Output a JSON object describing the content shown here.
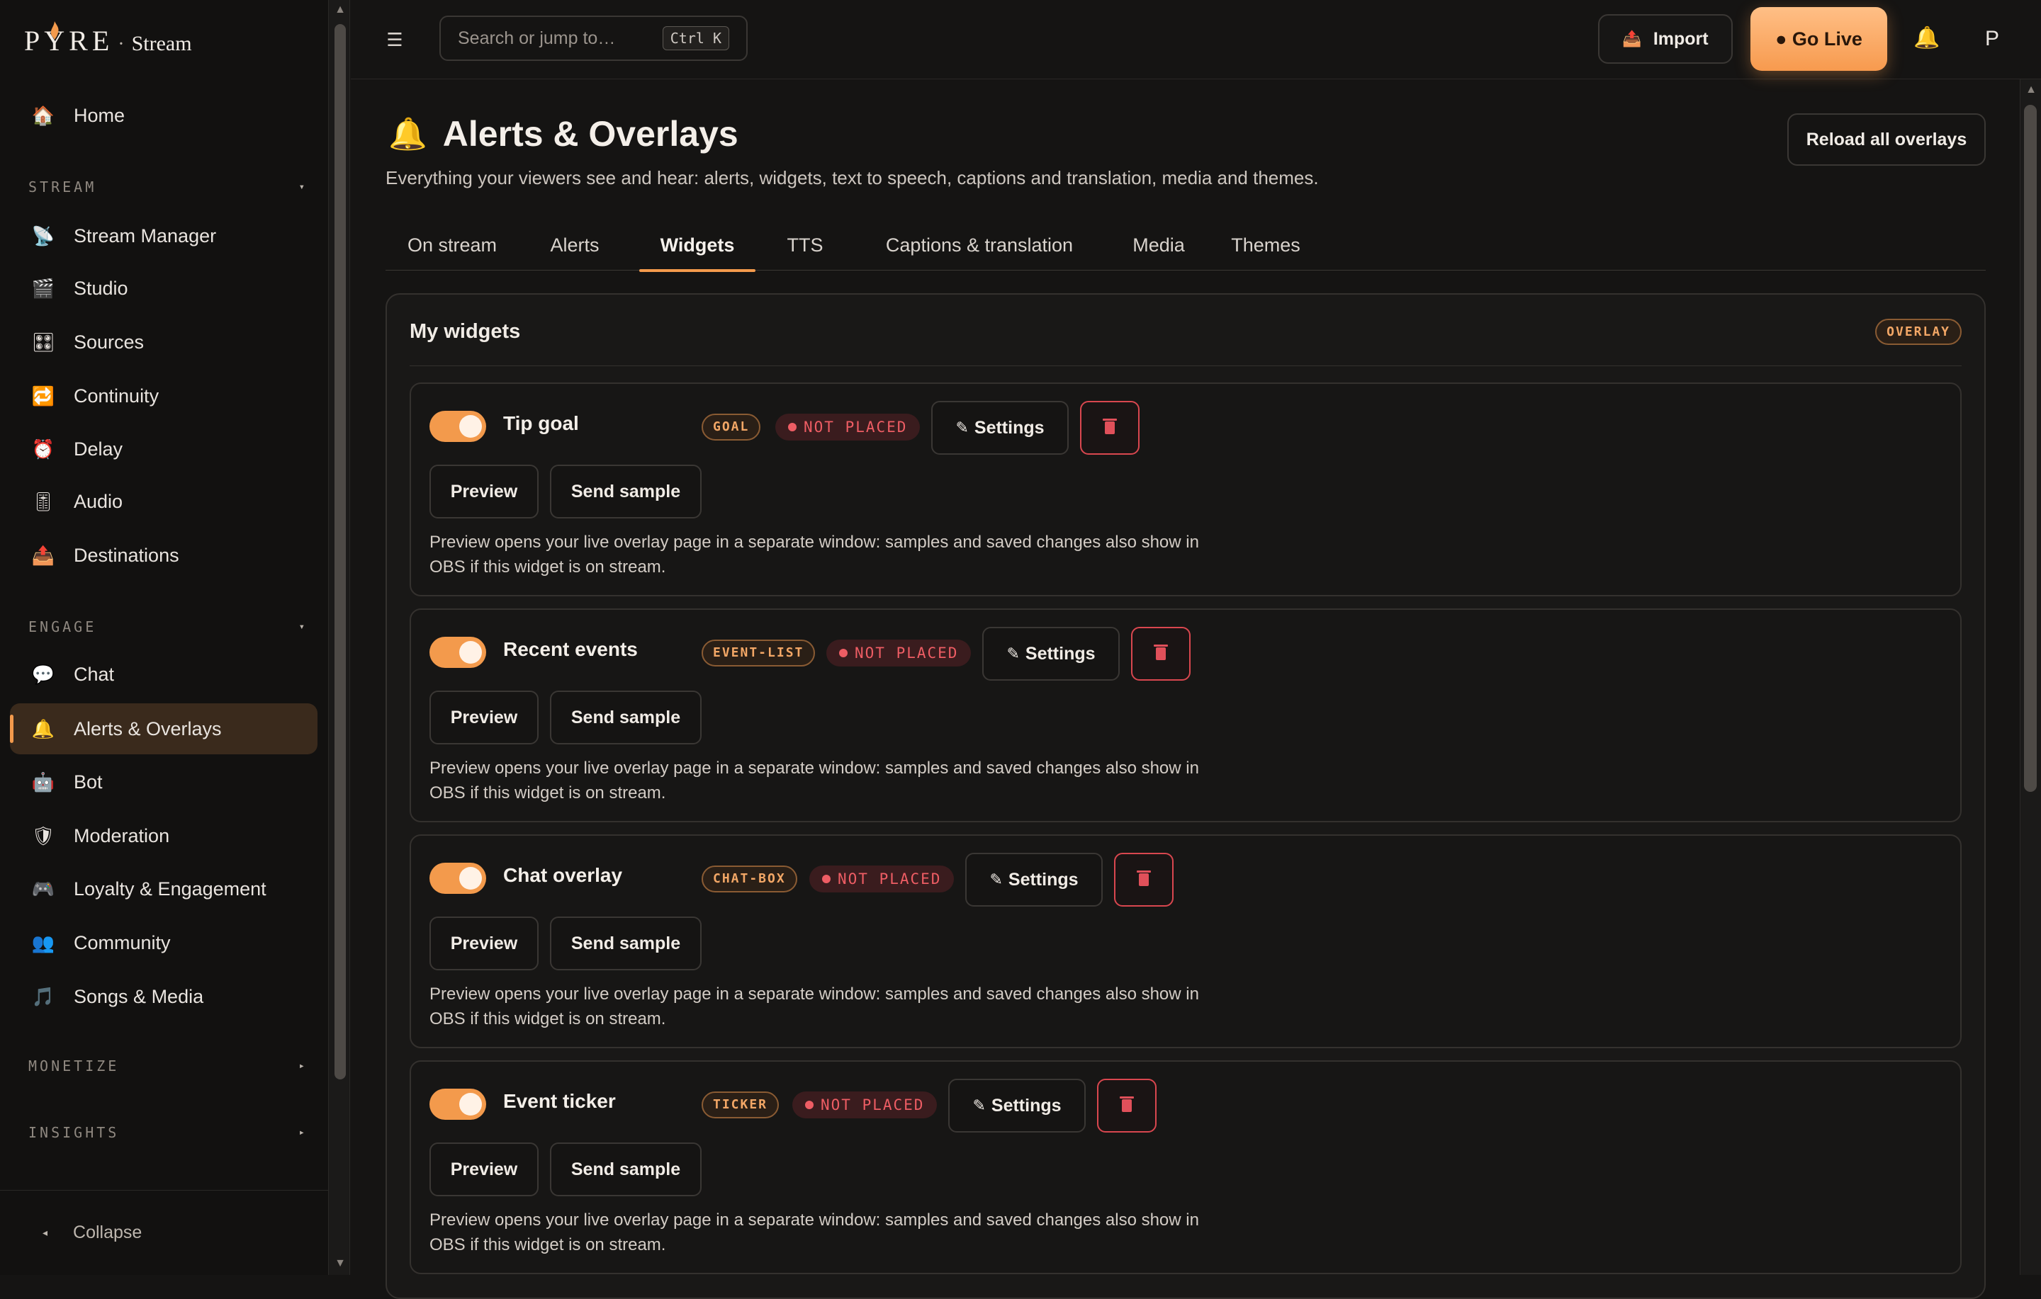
{
  "brand": {
    "name": "PYRE",
    "separator": "·",
    "product": "Stream"
  },
  "sidebar": {
    "top_items": [
      {
        "label": "Home",
        "icon": "home-icon",
        "glyph": "🏠"
      }
    ],
    "sections": [
      {
        "label": "STREAM",
        "caret": "▾",
        "items": [
          {
            "label": "Stream Manager",
            "icon": "satellite-icon",
            "glyph": "📡"
          },
          {
            "label": "Studio",
            "icon": "clapper-icon",
            "glyph": "🎬"
          },
          {
            "label": "Sources",
            "icon": "sources-icon",
            "glyph": "🎛"
          },
          {
            "label": "Continuity",
            "icon": "repeat-icon",
            "glyph": "🔁"
          },
          {
            "label": "Delay",
            "icon": "alarm-clock-icon",
            "glyph": "⏰"
          },
          {
            "label": "Audio",
            "icon": "audio-icon",
            "glyph": "🎚"
          },
          {
            "label": "Destinations",
            "icon": "outbox-icon",
            "glyph": "📤"
          }
        ]
      },
      {
        "label": "ENGAGE",
        "caret": "▾",
        "items": [
          {
            "label": "Chat",
            "icon": "speech-bubble-icon",
            "glyph": "💬"
          },
          {
            "label": "Alerts & Overlays",
            "icon": "bell-icon",
            "glyph": "🔔",
            "active": true
          },
          {
            "label": "Bot",
            "icon": "robot-icon",
            "glyph": "🤖"
          },
          {
            "label": "Moderation",
            "icon": "shield-icon",
            "glyph": "🛡"
          },
          {
            "label": "Loyalty & Engagement",
            "icon": "gamepad-icon",
            "glyph": "🎮"
          },
          {
            "label": "Community",
            "icon": "people-icon",
            "glyph": "👥"
          },
          {
            "label": "Songs & Media",
            "icon": "music-note-icon",
            "glyph": "🎵"
          }
        ]
      },
      {
        "label": "MONETIZE",
        "caret": "▸",
        "items": []
      },
      {
        "label": "INSIGHTS",
        "caret": "▸",
        "items": []
      }
    ],
    "collapse_label": "Collapse",
    "collapse_caret": "◂"
  },
  "topbar": {
    "menu_glyph": "☰",
    "search_placeholder": "Search or jump to…",
    "search_shortcut": "Ctrl K",
    "import_label": "Import",
    "import_glyph": "📤",
    "golive_label": "● Go Live",
    "bell_glyph": "🔔",
    "avatar_initial": "P"
  },
  "page": {
    "title": "Alerts & Overlays",
    "title_glyph": "🔔",
    "subtitle": "Everything your viewers see and hear: alerts, widgets, text to speech, captions and translation, media and themes.",
    "reload_label": "Reload all overlays",
    "tabs": [
      {
        "label": "On stream"
      },
      {
        "label": "Alerts"
      },
      {
        "label": "Widgets",
        "active": true
      },
      {
        "label": "TTS"
      },
      {
        "label": "Captions & translation"
      },
      {
        "label": "Media"
      },
      {
        "label": "Themes"
      }
    ]
  },
  "widgets_panel": {
    "title": "My widgets",
    "badge": "OVERLAY",
    "settings_label": "Settings",
    "settings_glyph": "✎",
    "preview_label": "Preview",
    "sample_label": "Send sample",
    "not_placed_label": "NOT PLACED",
    "help_text": "Preview opens your live overlay page in a separate window: samples and saved changes also show in OBS if this widget is on stream.",
    "widgets": [
      {
        "name": "Tip goal",
        "type": "GOAL",
        "enabled": true
      },
      {
        "name": "Recent events",
        "type": "EVENT-LIST",
        "enabled": true
      },
      {
        "name": "Chat overlay",
        "type": "CHAT-BOX",
        "enabled": true
      },
      {
        "name": "Event ticker",
        "type": "TICKER",
        "enabled": true
      }
    ]
  },
  "colors": {
    "accent": "#f39a4c",
    "danger": "#ee5d64",
    "background": "#151413"
  }
}
